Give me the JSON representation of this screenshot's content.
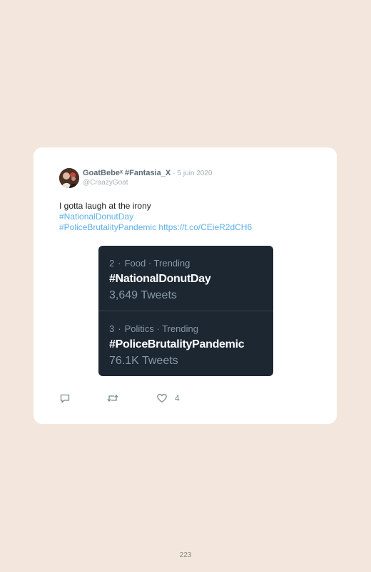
{
  "tweet": {
    "author": {
      "display_name": "GoatBebeˣ",
      "display_hashtag": "#Fantasia_X",
      "handle": "@CraazyGoat"
    },
    "separator": "·",
    "date": "5 juin 2020",
    "text_line1": "I gotta laugh at the irony",
    "hashtag1": "#NationalDonutDay",
    "hashtag2": "#PoliceBrutalityPandemic",
    "link": "https://t.co/CEieR2dCH6",
    "like_count": "4"
  },
  "trends": [
    {
      "rank": "2",
      "category": "Food",
      "status": "Trending",
      "name": "#NationalDonutDay",
      "count": "3,649 Tweets"
    },
    {
      "rank": "3",
      "category": "Politics",
      "status": "Trending",
      "name": "#PoliceBrutalityPandemic",
      "count": "76.1K Tweets"
    }
  ],
  "icons": {
    "reply": "reply-icon",
    "retweet": "retweet-icon",
    "like": "heart-icon"
  },
  "colors": {
    "background": "#f3e7dd",
    "link": "#5fb0e4",
    "trend_card": "#1c2732"
  },
  "page": {
    "number": "223"
  }
}
